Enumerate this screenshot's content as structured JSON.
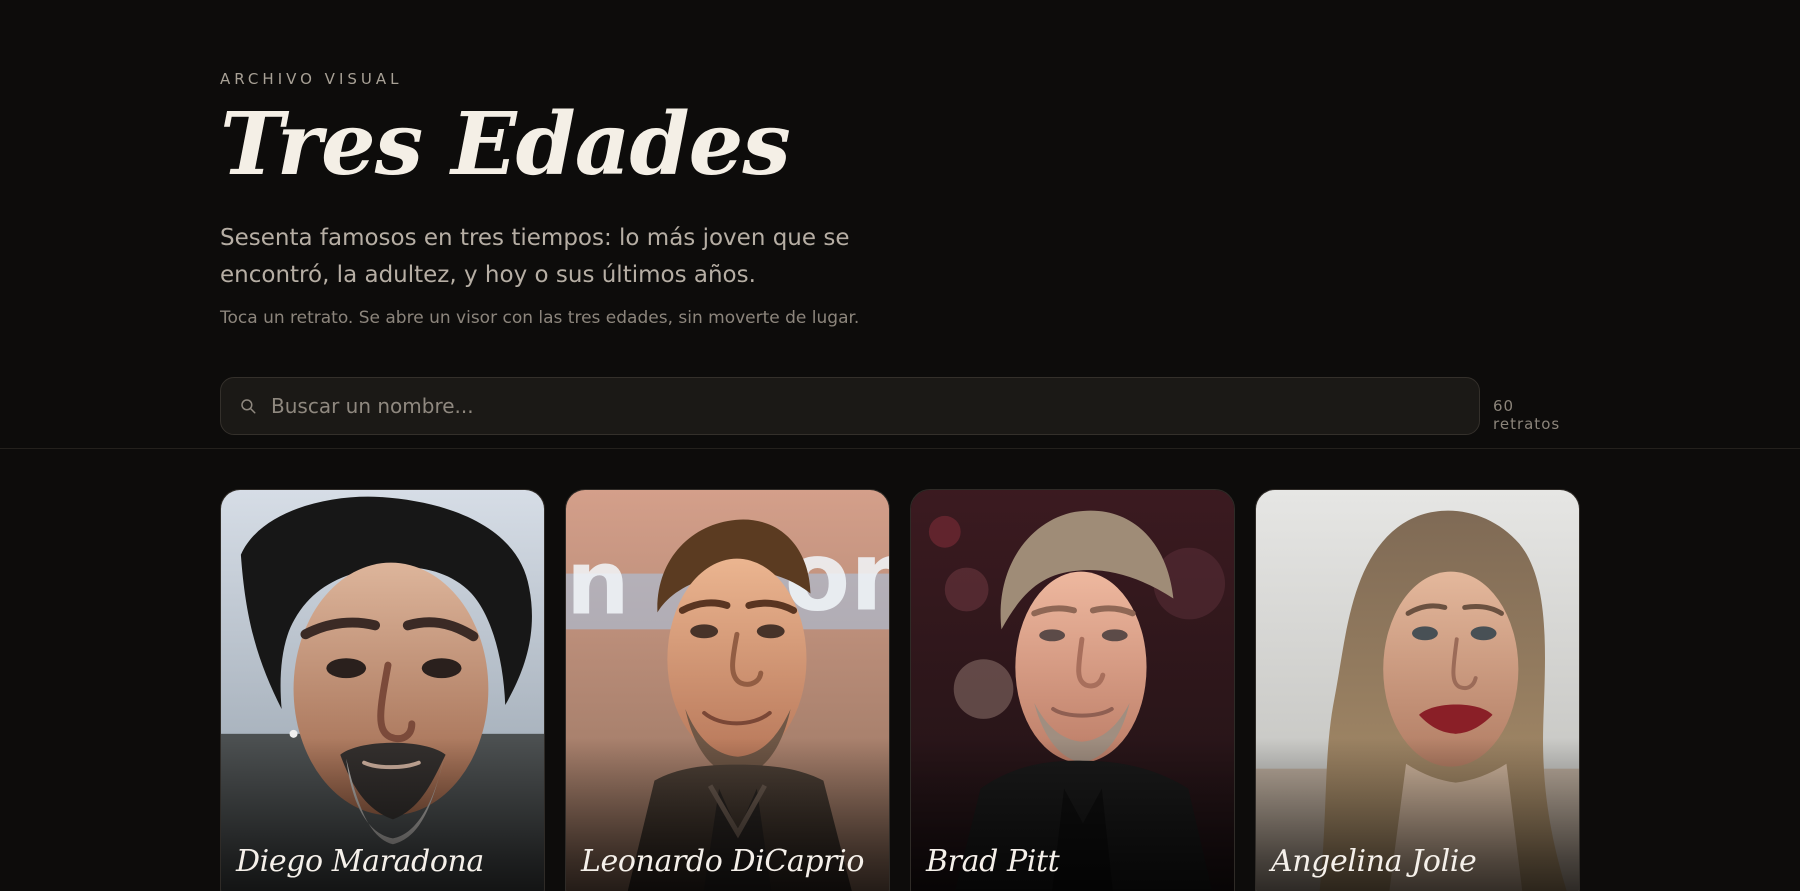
{
  "hero": {
    "eyebrow": "ARCHIVO VISUAL",
    "title": "Tres Edades",
    "lead": "Sesenta famosos en tres tiempos: lo más joven que se encontró, la adultez, y hoy o sus últimos años.",
    "hint": "Toca un retrato. Se abre un visor con las tres edades, sin moverte de lugar."
  },
  "search": {
    "placeholder": "Buscar un nombre...",
    "value": "",
    "icon": "search-icon"
  },
  "summary": {
    "count_label": "60 retratos"
  },
  "cards": [
    {
      "name": "Diego Maradona"
    },
    {
      "name": "Leonardo DiCaprio"
    },
    {
      "name": "Brad Pitt"
    },
    {
      "name": "Angelina Jolie"
    }
  ],
  "theme": {
    "background": "#0d0c0b",
    "card_border": "#2f2b27",
    "text_primary": "#f4efe6",
    "text_secondary": "#b6aea4",
    "accent_muted": "#8c857c"
  }
}
